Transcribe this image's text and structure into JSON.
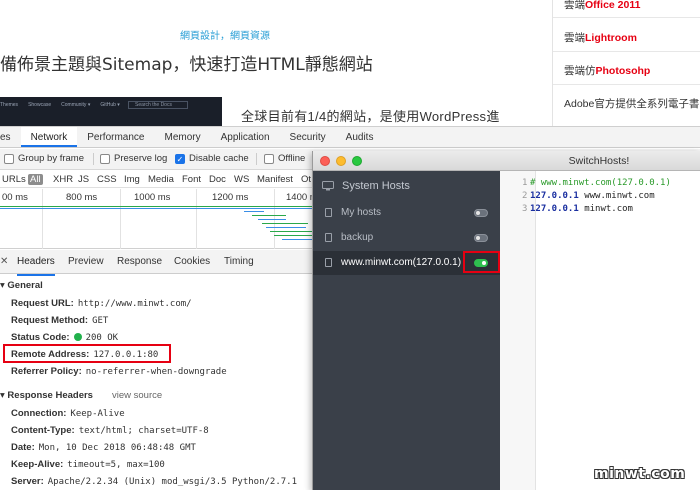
{
  "blog": {
    "categories": [
      "網頁設計",
      "網頁資源"
    ],
    "category_sep": "，",
    "title": "備佈景主題與Sitemap，快速打造HTML靜態網站",
    "banner_nav": [
      "Themes",
      "Showcase",
      "Community ▾",
      "GitHub ▾"
    ],
    "banner_search": "Search the Docs",
    "intro": "全球目前有1/4的網站，是使用WordPress進",
    "sidebar": [
      {
        "prefix": "雲端",
        "highlight": "Office 2011",
        "suffix": ""
      },
      {
        "prefix": "雲端",
        "highlight": "Lightroom",
        "suffix": ""
      },
      {
        "prefix": "雲端仿",
        "highlight": "Photosohp",
        "suffix": ""
      },
      {
        "prefix": "Adobe官方提供全系列電子書",
        "highlight": "",
        "suffix": ""
      }
    ],
    "highlight_color": "#e60012"
  },
  "devtools": {
    "tabs": [
      "es",
      "Network",
      "Performance",
      "Memory",
      "Application",
      "Security",
      "Audits"
    ],
    "active_tab": "Network",
    "toolbar": {
      "group_by_frame": "Group by frame",
      "preserve_log": "Preserve log",
      "disable_cache": "Disable cache",
      "offline": "Offline"
    },
    "filters": [
      "URLs",
      "All",
      "XHR",
      "JS",
      "CSS",
      "Img",
      "Media",
      "Font",
      "Doc",
      "WS",
      "Manifest",
      "Ot"
    ],
    "timeline_labels": [
      "00 ms",
      "800 ms",
      "1000 ms",
      "1200 ms",
      "1400 m"
    ],
    "panel_tabs": [
      "Headers",
      "Preview",
      "Response",
      "Cookies",
      "Timing"
    ],
    "active_panel_tab": "Headers",
    "general": {
      "heading": "General",
      "request_url_key": "Request URL:",
      "request_url": "http://www.minwt.com/",
      "method_key": "Request Method:",
      "method": "GET",
      "status_key": "Status Code:",
      "status": "200 OK",
      "remote_key": "Remote Address:",
      "remote": "127.0.0.1:80",
      "referrer_key": "Referrer Policy:",
      "referrer": "no-referrer-when-downgrade"
    },
    "response_headers": {
      "heading": "Response Headers",
      "view_source": "view source",
      "connection_key": "Connection:",
      "connection": "Keep-Alive",
      "content_type_key": "Content-Type:",
      "content_type": "text/html; charset=UTF-8",
      "date_key": "Date:",
      "date": "Mon, 10 Dec 2018 06:48:48 GMT",
      "keep_alive_key": "Keep-Alive:",
      "keep_alive": "timeout=5, max=100",
      "server_key": "Server:",
      "server": "Apache/2.2.34 (Unix) mod_wsgi/3.5 Python/2.7.1"
    }
  },
  "switchhosts": {
    "title": "SwitchHosts!",
    "system_hosts": "System Hosts",
    "items": [
      {
        "label": "My hosts",
        "on": false
      },
      {
        "label": "backup",
        "on": false
      },
      {
        "label": "www.minwt.com(127.0.0.1)",
        "on": true
      }
    ],
    "lines": [
      {
        "num": "1",
        "comment": "# www.minwt.com(127.0.0.1)",
        "ip": "",
        "host": ""
      },
      {
        "num": "2",
        "comment": "",
        "ip": "127.0.0.1",
        "host": "www.minwt.com"
      },
      {
        "num": "3",
        "comment": "",
        "ip": "127.0.0.1",
        "host": "minwt.com"
      }
    ]
  },
  "watermark": "minwt.com",
  "colors": {
    "accent_blue": "#1a73e8",
    "status_green": "#22b14c",
    "toggle_on": "#2fbf4f",
    "annotation_red": "#e60012",
    "sidebar_bg": "#3a4049"
  }
}
